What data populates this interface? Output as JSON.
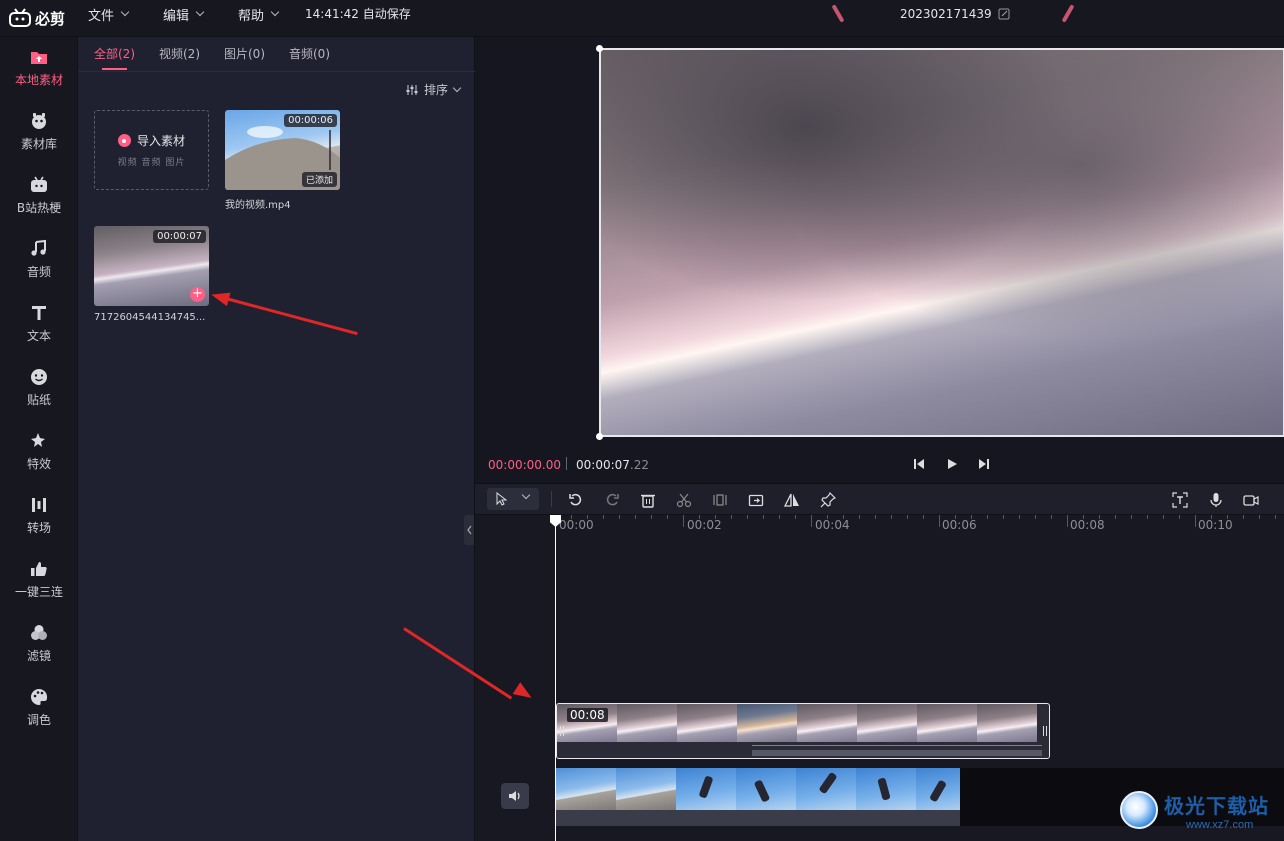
{
  "app": {
    "name": "必剪",
    "project_name": "202302171439",
    "autosave": "14:41:42 自动保存"
  },
  "menus": [
    {
      "label": "文件"
    },
    {
      "label": "编辑"
    },
    {
      "label": "帮助"
    }
  ],
  "sidebar": {
    "items": [
      {
        "label": "本地素材",
        "icon": "folder-upload-icon",
        "active": true
      },
      {
        "label": "素材库",
        "icon": "mascot-icon"
      },
      {
        "label": "B站热梗",
        "icon": "tv-icon"
      },
      {
        "label": "音频",
        "icon": "music-note-icon"
      },
      {
        "label": "文本",
        "icon": "text-t-icon"
      },
      {
        "label": "贴纸",
        "icon": "sticker-icon"
      },
      {
        "label": "特效",
        "icon": "sparkle-icon"
      },
      {
        "label": "转场",
        "icon": "transition-icon"
      },
      {
        "label": "一键三连",
        "icon": "thumbs-up-icon"
      },
      {
        "label": "滤镜",
        "icon": "filter-icon"
      },
      {
        "label": "调色",
        "icon": "palette-icon"
      }
    ]
  },
  "media": {
    "tabs": [
      {
        "label": "全部(2)",
        "active": true
      },
      {
        "label": "视频(2)"
      },
      {
        "label": "图片(0)"
      },
      {
        "label": "音频(0)"
      }
    ],
    "sort_label": "排序",
    "import": {
      "label": "导入素材",
      "sub": "视频 音频 图片"
    },
    "items": [
      {
        "name": "我的视频.mp4",
        "duration": "00:00:06",
        "status": "已添加"
      },
      {
        "name": "7172604544134745...",
        "duration": "00:00:07"
      }
    ]
  },
  "player": {
    "current_time": "00:00:00.00",
    "total_time_main": "00:00:07",
    "total_time_frac": ".22"
  },
  "timeline": {
    "ruler_labels": [
      "00:00",
      "00:02",
      "00:04",
      "00:06",
      "00:08",
      "00:10"
    ],
    "main_clip_duration": "00:08"
  },
  "watermark": {
    "main": "极光下载站",
    "sub": "www.xz7.com"
  },
  "colors": {
    "accent": "#ff5f85",
    "arrow": "#e02727",
    "background": "#1b1c26"
  }
}
